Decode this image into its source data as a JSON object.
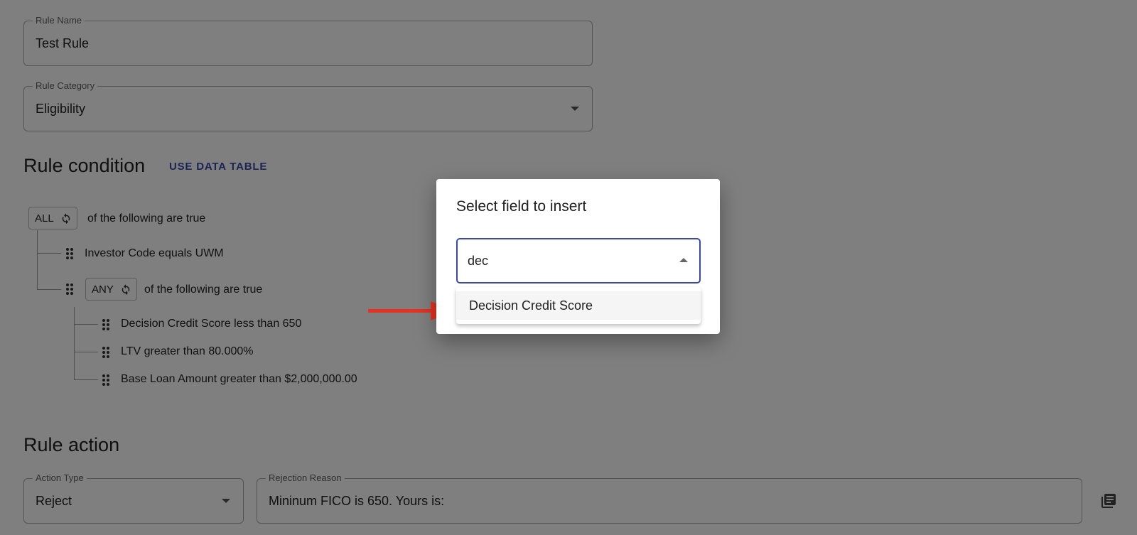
{
  "form": {
    "rule_name": {
      "label": "Rule Name",
      "value": "Test Rule"
    },
    "rule_category": {
      "label": "Rule Category",
      "value": "Eligibility"
    }
  },
  "rule_condition": {
    "title": "Rule condition",
    "use_data_table": "USE DATA TABLE",
    "root": {
      "operator": "ALL",
      "suffix": "of the following are true"
    },
    "conditions": [
      {
        "text": "Investor Code equals UWM"
      }
    ],
    "group": {
      "operator": "ANY",
      "suffix": "of the following are true",
      "conditions": [
        {
          "text": "Decision Credit Score less than 650"
        },
        {
          "text": "LTV greater than 80.000%"
        },
        {
          "text": "Base Loan Amount greater than $2,000,000.00"
        }
      ]
    }
  },
  "rule_action": {
    "title": "Rule action",
    "action_type": {
      "label": "Action Type",
      "value": "Reject"
    },
    "rejection_reason": {
      "label": "Rejection Reason",
      "value": "Mininum FICO is 650. Yours is:"
    }
  },
  "dialog": {
    "title": "Select field to insert",
    "search_value": "dec",
    "options": [
      "Decision Credit Score"
    ],
    "partial_button": "D"
  },
  "icons": {
    "refresh": "refresh-icon",
    "drag": "drag-handle-icon",
    "library": "library-books-icon",
    "arrow": "red-arrow-icon"
  },
  "colors": {
    "accent": "#3949ab",
    "arrow": "#e53222"
  }
}
